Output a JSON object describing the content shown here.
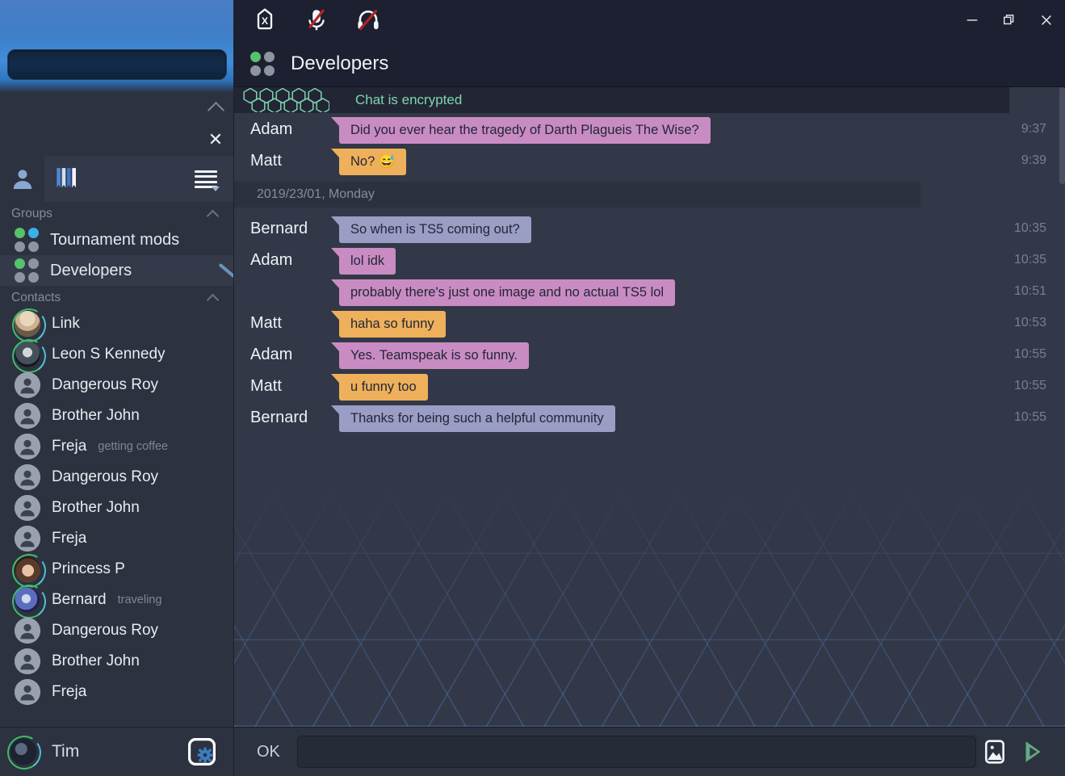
{
  "window": {
    "minimize_label": "—",
    "restore_label": "restore",
    "close_label": "✕"
  },
  "titlebar": {
    "icons": [
      {
        "name": "disconnect-icon",
        "label": "Disconnect"
      },
      {
        "name": "microphone-muted-icon",
        "label": "Microphone muted"
      },
      {
        "name": "headphones-muted-icon",
        "label": "Sound muted"
      }
    ]
  },
  "channel": {
    "title": "Developers",
    "icon": "group-icon"
  },
  "sidebar": {
    "search": {
      "value": "",
      "placeholder": ""
    },
    "controls": {
      "collapse": "collapse",
      "close": "✕"
    },
    "tabs": [
      {
        "name": "contacts-tab",
        "icon": "person-icon",
        "active": false
      },
      {
        "name": "bookmarks-tab",
        "icon": "bookmarks-icon",
        "active": true
      },
      {
        "name": "menu-tab",
        "icon": "hamburger-menu-icon",
        "active": false
      }
    ],
    "sections": [
      {
        "title": "Groups",
        "items": [
          {
            "label": "Tournament mods",
            "icon": "group-icon",
            "dots": [
              "g",
              "b",
              "",
              ""
            ],
            "selected": false,
            "status": ""
          },
          {
            "label": "Developers",
            "icon": "group-icon",
            "dots": [
              "g",
              "",
              "",
              ""
            ],
            "selected": true,
            "status": ""
          }
        ]
      },
      {
        "title": "Contacts",
        "items": [
          {
            "label": "Link",
            "avatar": "photo",
            "photo": "link",
            "ring": true,
            "status": ""
          },
          {
            "label": "Leon S Kennedy",
            "avatar": "photo",
            "photo": "leon",
            "ring": true,
            "status": ""
          },
          {
            "label": "Dangerous Roy",
            "avatar": "generic",
            "ring": false,
            "status": ""
          },
          {
            "label": "Brother John",
            "avatar": "generic",
            "ring": false,
            "status": ""
          },
          {
            "label": "Freja",
            "avatar": "generic",
            "ring": false,
            "status": "getting coffee"
          },
          {
            "label": "Dangerous Roy",
            "avatar": "generic",
            "ring": false,
            "status": ""
          },
          {
            "label": "Brother John",
            "avatar": "generic",
            "ring": false,
            "status": ""
          },
          {
            "label": "Freja",
            "avatar": "generic",
            "ring": false,
            "status": ""
          },
          {
            "label": "Princess P",
            "avatar": "photo",
            "photo": "princess",
            "ring": true,
            "status": ""
          },
          {
            "label": "Bernard",
            "avatar": "photo",
            "photo": "bernard",
            "ring": true,
            "status": "traveling"
          },
          {
            "label": "Dangerous Roy",
            "avatar": "generic",
            "ring": false,
            "status": ""
          },
          {
            "label": "Brother John",
            "avatar": "generic",
            "ring": false,
            "status": ""
          },
          {
            "label": "Freja",
            "avatar": "generic",
            "ring": false,
            "status": ""
          }
        ]
      }
    ],
    "user": {
      "name": "Tim",
      "avatar": "photo",
      "settings_icon": "gear-icon"
    }
  },
  "chat": {
    "encrypted_banner": {
      "text": "Chat is encrypted",
      "icon": "honeycomb-icon"
    },
    "messages": [
      {
        "sender": "Adam",
        "text": "Did you ever hear the tragedy of Darth Plagueis The Wise?",
        "time": "9:37",
        "color": "pink",
        "continued": false
      },
      {
        "sender": "Matt",
        "text": "No? 😅",
        "time": "9:39",
        "color": "orange",
        "continued": false
      },
      {
        "divider": "2019/23/01, Monday"
      },
      {
        "sender": "Bernard",
        "text": "So when is TS5 coming out?",
        "time": "10:35",
        "color": "blue",
        "continued": false
      },
      {
        "sender": "Adam",
        "text": "lol idk",
        "time": "10:35",
        "color": "pink",
        "continued": false
      },
      {
        "sender": "Adam",
        "text": "probably there's just one image and no actual TS5 lol",
        "time": "10:51",
        "color": "pink",
        "continued": true
      },
      {
        "sender": "Matt",
        "text": "haha so funny",
        "time": "10:53",
        "color": "orange",
        "continued": false
      },
      {
        "sender": "Adam",
        "text": "Yes. Teamspeak is so funny.",
        "time": "10:55",
        "color": "pink",
        "continued": false
      },
      {
        "sender": "Matt",
        "text": "u funny too",
        "time": "10:55",
        "color": "orange",
        "continued": false
      },
      {
        "sender": "Bernard",
        "text": "Thanks for being such a helpful community",
        "time": "10:55",
        "color": "blue",
        "continued": false
      }
    ]
  },
  "composer": {
    "status_label": "OK",
    "input_value": "",
    "input_placeholder": "",
    "attach_icon": "image-attach-icon",
    "send_icon": "send-icon"
  },
  "colors": {
    "accent_blue": "#3f8ddb",
    "bubble_pink": "#c98cc2",
    "bubble_orange": "#eeb05a",
    "bubble_blue": "#9a9dc4",
    "encrypted_green": "#7fd4ae",
    "send_green": "#63ab84",
    "online_green": "#56c36a",
    "online_cyan": "#3ab0e8"
  }
}
